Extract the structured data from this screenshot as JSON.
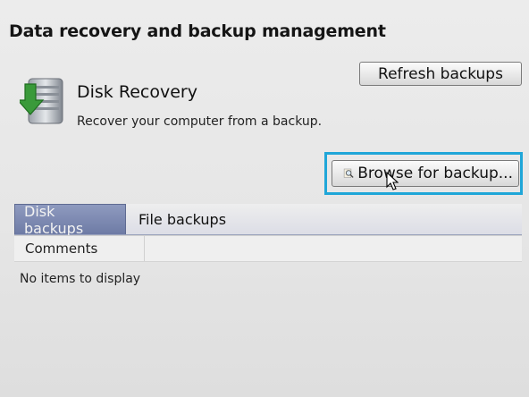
{
  "page": {
    "title": "Data recovery and backup management"
  },
  "disk_recovery": {
    "title": "Disk Recovery",
    "description": "Recover your computer from a backup.",
    "icon": "disk-recovery-icon"
  },
  "buttons": {
    "refresh_label": "Refresh backups",
    "browse_label": "Browse for backup...",
    "browse_icon": "magnifier-icon"
  },
  "tabs": [
    {
      "label": "Disk backups",
      "active": true
    },
    {
      "label": "File backups",
      "active": false
    }
  ],
  "table": {
    "columns": [
      "Comments"
    ],
    "empty_message": "No items to display"
  },
  "colors": {
    "focus_ring": "#1fa6d8",
    "active_tab": "#7b87b1"
  }
}
